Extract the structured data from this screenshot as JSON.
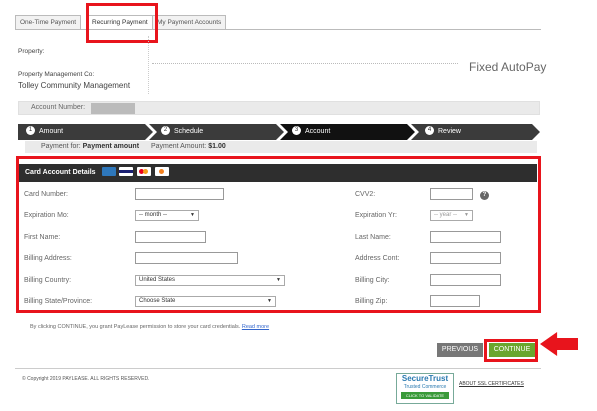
{
  "tabs": [
    {
      "label": "One-Time Payment"
    },
    {
      "label": "Recurring Payment"
    },
    {
      "label": "My Payment Accounts"
    }
  ],
  "property": {
    "property_label": "Property:",
    "management_label": "Property Management Co:",
    "management_value": "Tolley Community Management",
    "autopay_label": "Fixed AutoPay"
  },
  "account": {
    "label": "Account Number:"
  },
  "steps": [
    {
      "number": "1",
      "label": "Amount"
    },
    {
      "number": "2",
      "label": "Schedule"
    },
    {
      "number": "3",
      "label": "Account"
    },
    {
      "number": "4",
      "label": "Review"
    }
  ],
  "payment": {
    "for_label": "Payment for:",
    "for_value": "Payment amount",
    "amount_label": "Payment Amount:",
    "amount_value": "$1.00"
  },
  "card_form": {
    "title": "Card Account Details",
    "card_icons": [
      {
        "name": "amex-icon",
        "color": "#2e77bb"
      },
      {
        "name": "visa-icon",
        "color": "#1a1f71"
      },
      {
        "name": "mastercard-icon",
        "color": "#eb001b"
      },
      {
        "name": "discover-icon",
        "color": "#f58220"
      }
    ],
    "card_number_label": "Card Number:",
    "cvv2_label": "CVV2:",
    "exp_mo_label": "Expiration Mo:",
    "exp_mo_value": "-- month --",
    "exp_yr_label": "Expiration Yr:",
    "exp_yr_value": "-- year --",
    "first_name_label": "First Name:",
    "last_name_label": "Last Name:",
    "billing_address_label": "Billing Address:",
    "address_cont_label": "Address Cont:",
    "billing_country_label": "Billing Country:",
    "billing_country_value": "United States",
    "billing_city_label": "Billing City:",
    "billing_state_label": "Billing State/Province:",
    "billing_state_value": "Choose State",
    "billing_zip_label": "Billing Zip:",
    "help_glyph": "?"
  },
  "consent": {
    "text": "By clicking CONTINUE, you grant PayLease permission to store your card credentials.",
    "link": "Read more"
  },
  "buttons": {
    "previous": "PREVIOUS",
    "continue": "CONTINUE"
  },
  "footer": {
    "copyright": "© Copyright 2019 PAYLEASE. ALL RIGHTS RESERVED.",
    "trust_title": "SecureTrust",
    "trust_sub": "Trusted Commerce",
    "trust_action": "CLICK TO VALIDATE",
    "about_ssl": "ABOUT SSL CERTIFICATES"
  },
  "colors": {
    "highlight": "#e8141c",
    "continue_button": "#6aa62e",
    "previous_button": "#777777",
    "step_bar": "#3b3b3b"
  }
}
